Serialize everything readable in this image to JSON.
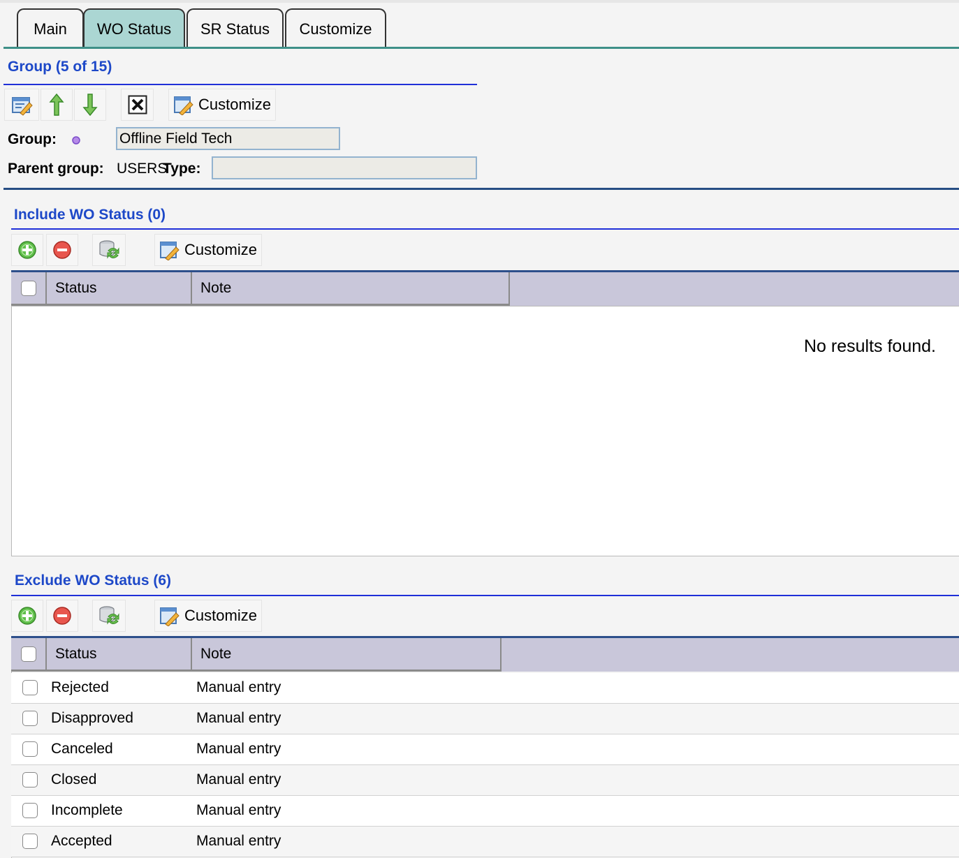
{
  "tabs": [
    {
      "label": "Main",
      "active": false
    },
    {
      "label": "WO Status",
      "active": true
    },
    {
      "label": "SR Status",
      "active": false
    },
    {
      "label": "Customize",
      "active": false
    }
  ],
  "group_section": {
    "title": "Group (5 of 15)",
    "toolbar": {
      "customize_label": "Customize"
    },
    "group_label": "Group:",
    "group_value": "Offline Field Tech",
    "parent_group_label": "Parent group:",
    "parent_group_value": "USERS",
    "type_label": "Type:",
    "type_value": ""
  },
  "include_section": {
    "title": "Include WO Status (0)",
    "toolbar": {
      "customize_label": "Customize"
    },
    "columns": [
      "Status",
      "Note"
    ],
    "empty_message": "No results found."
  },
  "exclude_section": {
    "title": "Exclude WO Status (6)",
    "toolbar": {
      "customize_label": "Customize"
    },
    "columns": [
      "Status",
      "Note"
    ],
    "rows": [
      {
        "status": "Rejected",
        "note": "Manual entry"
      },
      {
        "status": "Disapproved",
        "note": "Manual entry"
      },
      {
        "status": "Canceled",
        "note": "Manual entry"
      },
      {
        "status": "Closed",
        "note": "Manual entry"
      },
      {
        "status": "Incomplete",
        "note": "Manual entry"
      },
      {
        "status": "Accepted",
        "note": "Manual entry"
      }
    ]
  },
  "colors": {
    "active_tab": "#abd6d3",
    "section_title": "#1d48c8",
    "grid_header": "#c9c7da"
  },
  "icons": {
    "edit": "edit-record-icon",
    "up": "move-up-arrow-icon",
    "down": "move-down-arrow-icon",
    "delete": "delete-x-icon",
    "customize": "customize-pencil-icon",
    "add": "add-green-plus-icon",
    "remove": "remove-red-minus-icon",
    "refresh": "refresh-database-icon"
  }
}
